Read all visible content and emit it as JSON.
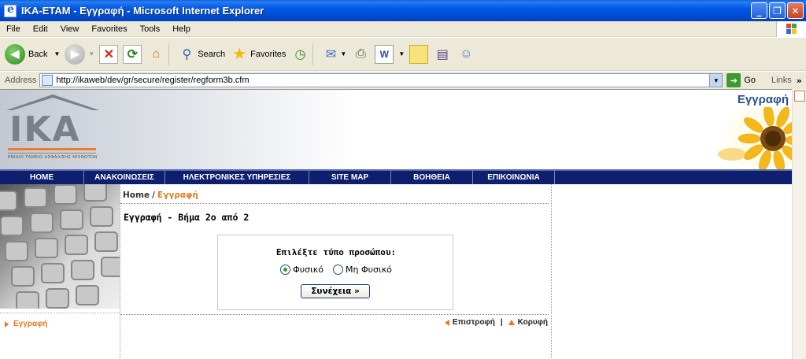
{
  "window": {
    "title": "IKA-ETAM - Εγγραφή - Microsoft Internet Explorer",
    "minimize": "_",
    "maximize": "❐",
    "close": "✕"
  },
  "menu": [
    "File",
    "Edit",
    "View",
    "Favorites",
    "Tools",
    "Help"
  ],
  "toolbar": {
    "back": "Back",
    "search": "Search",
    "favorites": "Favorites"
  },
  "address": {
    "label": "Address",
    "url": "http://ikaweb/dev/gr/secure/register/regform3b.cfm",
    "go": "Go",
    "links": "Links"
  },
  "site": {
    "logo_text": "IKA",
    "logo_tagline": "ΕΝΙΑΙΟ ΤΑΜΕΙΟ ΑΣΦΑΛΙΣΗΣ ΜΙΣΘΩΤΩΝ",
    "header_title": "Εγγραφή",
    "nav": [
      "HOME",
      "ΑΝΑΚΟΙΝΩΣΕΙΣ",
      "ΗΛΕΚΤΡΟΝΙΚΕΣ ΥΠΗΡΕΣΙΕΣ",
      "SITE MAP",
      "ΒΟΗΘΕΙΑ",
      "ΕΠΙΚΟΙΝΩΝΙΑ"
    ],
    "left_link": "Εγγραφή",
    "breadcrumb_home": "Home",
    "breadcrumb_sep": "/",
    "breadcrumb_current": "Εγγραφή",
    "page_title": "Εγγραφή - Βήμα 2ο από 2",
    "form_label": "Επιλέξτε τύπο προσώπου:",
    "radio_physical": "Φυσικό",
    "radio_nonphysical": "Μη Φυσικό",
    "radio_selected": "Φυσικό",
    "submit": "Συνέχεια »",
    "back_link": "Επιστροφή",
    "top_link": "Κορυφή",
    "bottom_sep": "|"
  },
  "colors": {
    "nav_bg": "#0d1f6d",
    "accent_orange": "#e07b22",
    "header_title": "#2b4e8f"
  }
}
